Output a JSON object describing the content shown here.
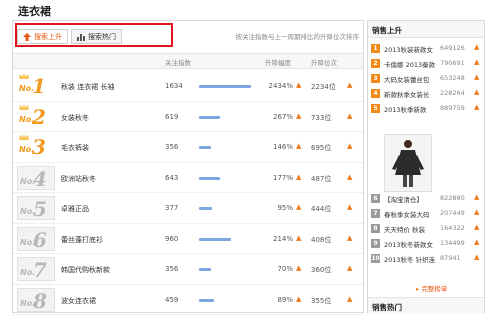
{
  "page_title": "连衣裙",
  "tabs": [
    {
      "label": "搜索上升",
      "active": true
    },
    {
      "label": "搜索热门",
      "active": false
    }
  ],
  "hint": "按关注指数与上一周期排比的升降位次排序",
  "columns": [
    "关注指数",
    "升降幅度",
    "升降位次"
  ],
  "rows": [
    {
      "no": "No.",
      "rank": "1",
      "top": true,
      "keyword": "秋装 连衣裙 长袖",
      "index": "1634",
      "bar_fraction": 0.95,
      "rate": "2434%",
      "pos": "2234位"
    },
    {
      "no": "No.",
      "rank": "2",
      "top": true,
      "keyword": "女装秋冬",
      "index": "619",
      "bar_fraction": 0.38,
      "rate": "267%",
      "pos": "733位"
    },
    {
      "no": "No.",
      "rank": "3",
      "top": true,
      "keyword": "毛衣裤装",
      "index": "356",
      "bar_fraction": 0.22,
      "rate": "146%",
      "pos": "695位"
    },
    {
      "no": "No.",
      "rank": "4",
      "top": false,
      "keyword": "欧洲站秋冬",
      "index": "643",
      "bar_fraction": 0.39,
      "rate": "177%",
      "pos": "487位"
    },
    {
      "no": "No.",
      "rank": "5",
      "top": false,
      "keyword": "卓雅正品",
      "index": "377",
      "bar_fraction": 0.23,
      "rate": "95%",
      "pos": "444位"
    },
    {
      "no": "No.",
      "rank": "6",
      "top": false,
      "keyword": "蕾丝蓬打底衫",
      "index": "960",
      "bar_fraction": 0.58,
      "rate": "214%",
      "pos": "408位"
    },
    {
      "no": "No.",
      "rank": "7",
      "top": false,
      "keyword": "韩国代购秋新款",
      "index": "356",
      "bar_fraction": 0.22,
      "rate": "70%",
      "pos": "360位"
    },
    {
      "no": "No.",
      "rank": "8",
      "top": false,
      "keyword": "波女连衣裙",
      "index": "459",
      "bar_fraction": 0.28,
      "rate": "89%",
      "pos": "355位"
    }
  ],
  "sidebar": {
    "title": "销售上升",
    "items_top": [
      {
        "n": "1",
        "name": "2013秋装新款女",
        "value": "649126",
        "hot": true
      },
      {
        "n": "2",
        "name": "卡倫娜 2013秦款",
        "value": "790691",
        "hot": true
      },
      {
        "n": "3",
        "name": "大码女装蕾丝包",
        "value": "653248",
        "hot": true
      },
      {
        "n": "4",
        "name": "新款秋季女装长",
        "value": "228264",
        "hot": true
      },
      {
        "n": "5",
        "name": "2013秋季新款",
        "value": "889759",
        "hot": true
      }
    ],
    "items_bottom": [
      {
        "n": "6",
        "name": "【淘宝清仓】",
        "value": "822880",
        "hot": false
      },
      {
        "n": "7",
        "name": "春秋季女装大码",
        "value": "207449",
        "hot": false
      },
      {
        "n": "8",
        "name": "天天特价 秋装",
        "value": "164322",
        "hot": false
      },
      {
        "n": "9",
        "name": "2013秋冬新款女",
        "value": "134499",
        "hot": false
      },
      {
        "n": "10",
        "name": "2013秋冬 针织连",
        "value": "87941",
        "hot": false
      }
    ],
    "more": "完整榜单",
    "title2": "销售热门"
  },
  "colors": {
    "accent": "#e8560f",
    "bar": "#7ba6de",
    "top_rank": "#f39a1e",
    "highlight_box": "#e0141e"
  }
}
